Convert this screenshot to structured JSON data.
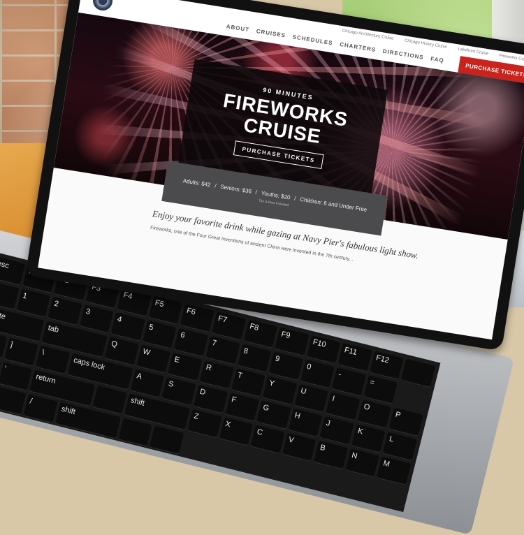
{
  "site": {
    "top_links": [
      "Chicago Architecture Cruise",
      "Chicago History Cruise",
      "Lakefront Cruise",
      "Fireworks Cruise"
    ],
    "nav": [
      "ABOUT",
      "CRUISES",
      "SCHEDULES",
      "CHARTERS",
      "DIRECTIONS",
      "FAQ"
    ],
    "purchase_top": "PURCHASE TICKETS"
  },
  "hero": {
    "kicker": "90 MINUTES",
    "title_line1": "FIREWORKS",
    "title_line2": "CRUISE",
    "button": "PURCHASE TICKETS"
  },
  "prices": {
    "adults": "Adults: $42",
    "sep1": "/",
    "seniors": "Seniors: $36",
    "sep2": "/",
    "youths": "Youths: $20",
    "sep3": "/",
    "children": "Children: 6 and Under Free",
    "note": "Tax & fees included"
  },
  "body": {
    "tagline": "Enjoy your favorite drink while gazing at Navy Pier's fabulous light show.",
    "paragraph": "Fireworks, one of the Four Great Inventions of ancient China were invented in the 7th century..."
  },
  "keyboard": {
    "keys": [
      "esc",
      "F1",
      "F2",
      "F3",
      "F4",
      "F5",
      "F6",
      "F7",
      "F8",
      "F9",
      "F10",
      "F11",
      "F12",
      "",
      "~",
      "1",
      "2",
      "3",
      "4",
      "5",
      "6",
      "7",
      "8",
      "9",
      "0",
      "-",
      "=",
      "delete",
      "tab",
      "Q",
      "W",
      "E",
      "R",
      "T",
      "Y",
      "U",
      "I",
      "O",
      "P",
      "[",
      "]",
      "\\",
      "caps lock",
      "A",
      "S",
      "D",
      "F",
      "G",
      "H",
      "J",
      "K",
      "L",
      ";",
      "'",
      "return",
      "",
      "shift",
      "Z",
      "X",
      "C",
      "V",
      "B",
      "N",
      "M",
      ",",
      ".",
      "/",
      "shift",
      "",
      ""
    ]
  }
}
